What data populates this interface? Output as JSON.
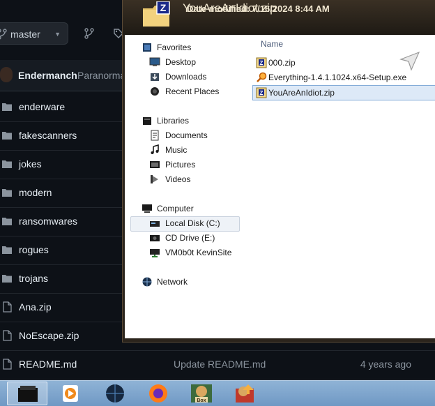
{
  "repo": {
    "branch": "master",
    "last_commit": {
      "author": "Endermanch",
      "message": "Paranorma"
    },
    "entries": [
      {
        "name": "enderware",
        "type": "folder",
        "message": "",
        "age": ""
      },
      {
        "name": "fakescanners",
        "type": "folder",
        "message": "",
        "age": ""
      },
      {
        "name": "jokes",
        "type": "folder",
        "message": "",
        "age": ""
      },
      {
        "name": "modern",
        "type": "folder",
        "message": "",
        "age": ""
      },
      {
        "name": "ransomwares",
        "type": "folder",
        "message": "",
        "age": ""
      },
      {
        "name": "rogues",
        "type": "folder",
        "message": "",
        "age": ""
      },
      {
        "name": "trojans",
        "type": "folder",
        "message": "",
        "age": ""
      },
      {
        "name": "Ana.zip",
        "type": "file",
        "message": "",
        "age": ""
      },
      {
        "name": "NoEscape.zip",
        "type": "file",
        "message": "",
        "age": ""
      },
      {
        "name": "README.md",
        "type": "file",
        "message": "Update README.md",
        "age": "4 years ago"
      }
    ]
  },
  "explorer": {
    "preview": {
      "title": "YouAreAnIdiot.zip",
      "date": "Date modified: 7/16/2024 8:44 AM"
    },
    "column_name": "Name",
    "nav": {
      "favorites": {
        "label": "Favorites",
        "items": [
          "Desktop",
          "Downloads",
          "Recent Places"
        ]
      },
      "libraries": {
        "label": "Libraries",
        "items": [
          "Documents",
          "Music",
          "Pictures",
          "Videos"
        ]
      },
      "computer": {
        "label": "Computer",
        "items": [
          "Local Disk (C:)",
          "CD Drive (E:)",
          "VM0b0t KevinSite"
        ]
      },
      "network": {
        "label": "Network"
      }
    },
    "files": [
      {
        "name": "000.zip",
        "icon": "zip-archive-icon"
      },
      {
        "name": "Everything-1.4.1.1024.x64-Setup.exe",
        "icon": "search-magnifier-icon"
      },
      {
        "name": "YouAreAnIdiot.zip",
        "icon": "zip-archive-icon",
        "selected": true
      }
    ]
  },
  "taskbar": {
    "items": [
      "start-orb",
      "media-player",
      "internet-explorer",
      "firefox",
      "box-game",
      "sandbox-app"
    ]
  },
  "colors": {
    "github_bg": "#0d1117",
    "github_text": "#e6edf3",
    "github_muted": "#8b949e",
    "explorer_selection": "#dde9f7",
    "taskbar": "#7aa2cc"
  }
}
